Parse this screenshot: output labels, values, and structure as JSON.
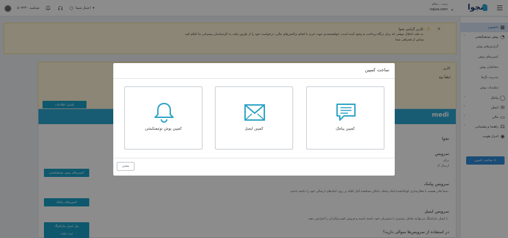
{
  "topbar": {
    "logo_text": "نجوا",
    "user_greeting": "زینب ، سلام",
    "user_name": "najva.com",
    "account_id": "شناسه : ۵۰۲۲۳",
    "account_menu_label": "اعتبار شما"
  },
  "sidebar": {
    "items": [
      {
        "label": "داشبورد",
        "icon": "dashboard-icon"
      },
      {
        "label": "پوش نوتیفیکیشن",
        "icon": "bell-icon"
      },
      {
        "label": "پیامک",
        "icon": "sms-icon"
      },
      {
        "label": "ایمیل",
        "icon": "mail-icon"
      },
      {
        "label": "مالی",
        "icon": "wallet-icon"
      },
      {
        "label": "راهنما و پشتیبانی",
        "icon": "headset-icon"
      },
      {
        "label": "احراز هویت",
        "icon": "id-icon"
      }
    ],
    "push_subitems": [
      "گزارش‌های پوش",
      "کمپین‌های پوش",
      "مخاطبان پوش",
      "مدیریت تگ‌ها",
      "تنظیمات پوش"
    ],
    "cta_label": "ساخت کمپین +"
  },
  "alert": {
    "title": "کاربر گرامی نجوا،",
    "line1": "به علت اختلال موقتی که برای درگاه پرداخت به وجود آمده است، خواهشمندیم جهت خرید یا انجام تراکنش‌های مالی، درخواست خود را از طریق تیکت به کارشناسان پشتیبانی ما اعلام کنید.",
    "line2": "سپاس از همراهی شما"
  },
  "alert2": {
    "title": "کاربر",
    "line1": "لطفاً نوع",
    "button": "تکمیل اطلاعات"
  },
  "card": {
    "header": "medi",
    "intro": "نجوا",
    "services": [
      {
        "title": "سرویس",
        "desc": "برای",
        "desc2": "ارسال ک",
        "button": "کمپین‌های پوش نوتیفیکیشن"
      },
      {
        "title": "سرویس پیامک",
        "desc": "شما قادر هستید با فعال‌سازی کوتاه‌کننده لینک پیامک، امکان مشاهده آمار کلیک بر روی لینک‌های ارسالی خود را داشته باشید.",
        "button": "کمپین‌های پیامک"
      },
      {
        "title": "سرویس ایمیل",
        "desc": "با ایمیل مارکتینگ می‌توانید تعامل بیشتری با مشتریان خود داشته باشید و فروش کسب‌وکارتان را افزایش دهید.",
        "button": "پنل ایمیل مارکتینگ"
      },
      {
        "title": "در استفاده از سرویس‌ها سوالی دارید؟",
        "desc": "",
        "button": "ثبت تیکت"
      }
    ]
  },
  "modal": {
    "title": "ساخت کمپین",
    "options": [
      {
        "label": "کمپین پیامک",
        "icon": "sms-bubble-icon"
      },
      {
        "label": "کمپین ایمیل",
        "icon": "envelope-icon"
      },
      {
        "label": "کمپین پوش نوتیفیکیشن",
        "icon": "bell-icon"
      }
    ],
    "close_label": "بستن",
    "accent": "#2ca3c6"
  }
}
